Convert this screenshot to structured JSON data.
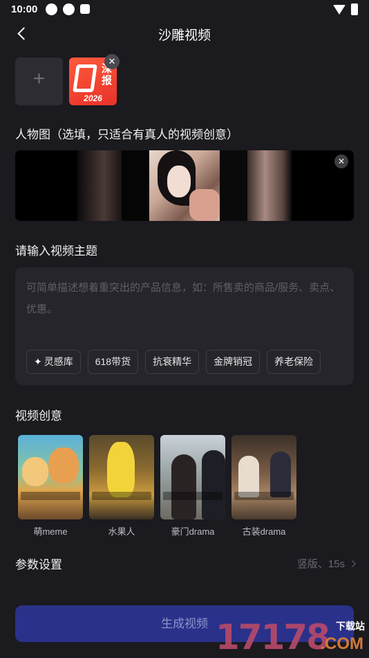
{
  "status_bar": {
    "time": "10:00"
  },
  "header": {
    "title": "沙雕视频"
  },
  "upload": {
    "add_symbol": "+",
    "logo_text": "深报",
    "logo_year": "2026",
    "remove_symbol": "✕"
  },
  "person": {
    "title": "人物图（选填，只适合有真人的视频创意）",
    "remove_symbol": "✕"
  },
  "topic": {
    "title": "请输入视频主题",
    "placeholder": "可简单描述想着重突出的产品信息，如：所售卖的商品/服务、卖点、优惠。",
    "chips": [
      "灵感库",
      "618带货",
      "抗衰精华",
      "金牌销冠",
      "养老保险"
    ]
  },
  "creative": {
    "title": "视频创意",
    "items": [
      {
        "label": "萌meme"
      },
      {
        "label": "水果人"
      },
      {
        "label": "豪门drama"
      },
      {
        "label": "古装drama"
      }
    ]
  },
  "params": {
    "title": "参数设置",
    "value": "竖版、15s"
  },
  "generate": {
    "label": "生成视频"
  },
  "watermark": {
    "number": "17178",
    "site": "下载站",
    "domain": ".COM"
  },
  "colors": {
    "background": "#1a1a1f",
    "button": "#2a318a",
    "button_text": "#8e93c8",
    "watermark": "#b84a6a"
  }
}
